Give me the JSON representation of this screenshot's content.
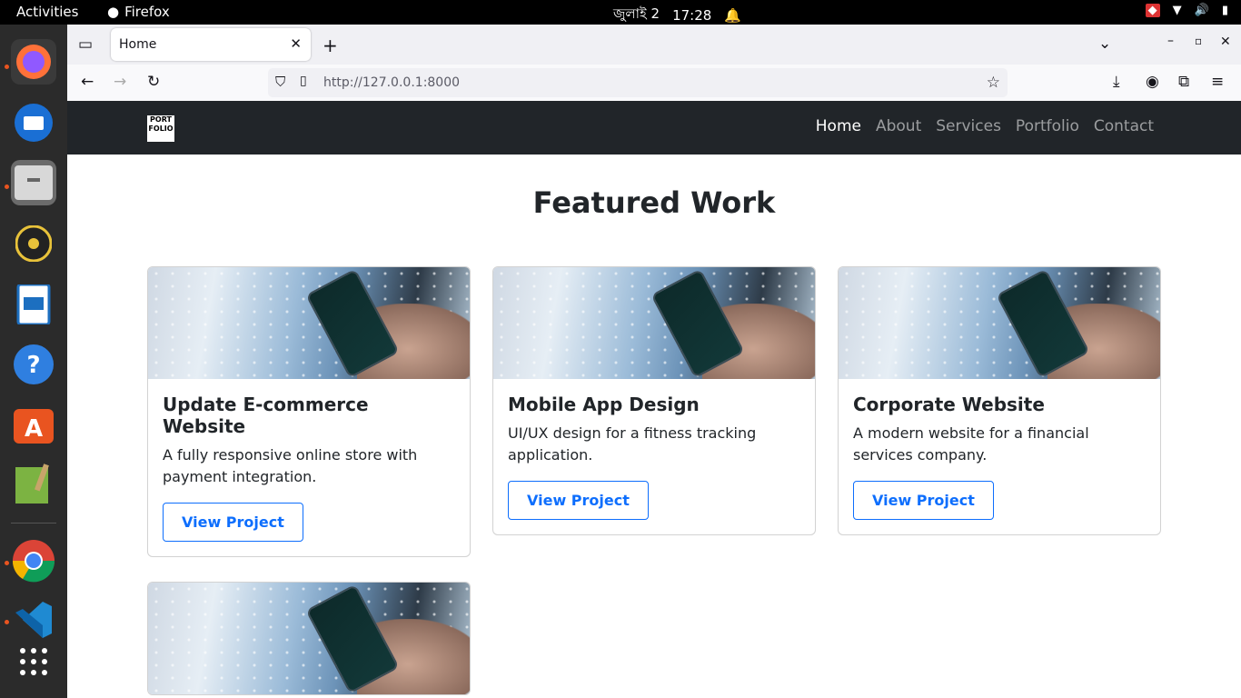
{
  "system": {
    "activities": "Activities",
    "app_name": "Firefox",
    "date": "জুলাই 2",
    "time": "17:28"
  },
  "browser": {
    "tab_title": "Home",
    "url_host": "http://127.0.0.1",
    "url_port": ":8000"
  },
  "site": {
    "logo_text": "PORT FOLIO",
    "nav": [
      "Home",
      "About",
      "Services",
      "Portfolio",
      "Contact"
    ],
    "heading": "Featured Work",
    "cards": [
      {
        "title": "Update E-commerce Website",
        "text": "A fully responsive online store with payment integration.",
        "button": "View Project"
      },
      {
        "title": "Mobile App Design",
        "text": "UI/UX design for a fitness tracking application.",
        "button": "View Project"
      },
      {
        "title": "Corporate Website",
        "text": "A modern website for a financial services company.",
        "button": "View Project"
      }
    ]
  },
  "colors": {
    "navbar": "#212529",
    "primary": "#0d6efd"
  }
}
